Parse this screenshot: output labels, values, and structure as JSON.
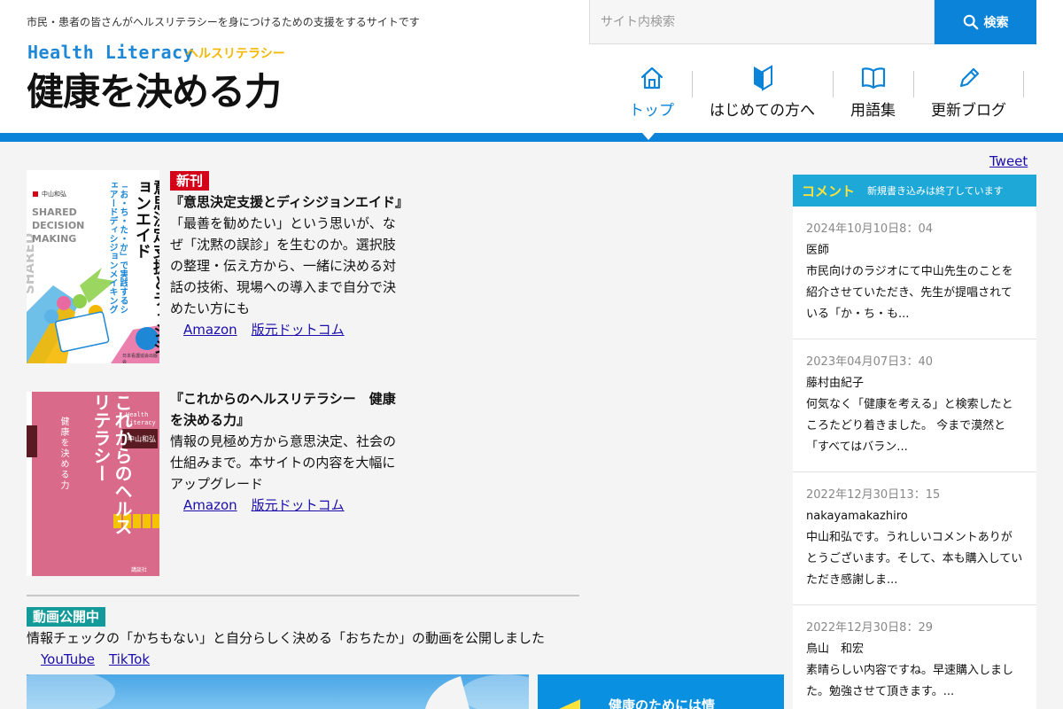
{
  "header": {
    "tagline": "市民・患者の皆さんがヘルスリテラシーを身につけるための支援をするサイトです",
    "brand_en": "Health Literacy",
    "brand_ja_sub": "ヘルスリテラシー",
    "brand_title": "健康を決める力"
  },
  "search": {
    "placeholder": "サイト内検索",
    "button_label": "検索"
  },
  "nav": [
    {
      "label": "トップ",
      "icon": "home-icon",
      "active": true
    },
    {
      "label": "はじめての方へ",
      "icon": "beginner-mark-icon",
      "active": false
    },
    {
      "label": "用語集",
      "icon": "book-icon",
      "active": false
    },
    {
      "label": "更新ブログ",
      "icon": "pencil-icon",
      "active": false
    }
  ],
  "colors": {
    "primary_blue": "#0a83d8",
    "brand_yellow": "#f5b800",
    "new_badge_red": "#d4001a",
    "video_badge_teal": "#159a9a",
    "comments_head": "#1ea8d8"
  },
  "tweet_label": "Tweet",
  "books": [
    {
      "badge": "新刊",
      "title": "『意思決定支援とディシジョンエイド』",
      "description": "「最善を勧めたい」という思いが、なぜ「沈黙の誤診」を生むのか。選択肢の整理・伝え方から、一緒に決める対話の技術、現場への導入まで自分で決めたい方にも",
      "links": [
        "Amazon",
        "版元ドットコム"
      ],
      "cover": {
        "author": "中山和弘",
        "title": "意思決定支援とディシジョンエイド",
        "subtitle": "「お・ち・た・か」で実践するシェアードディシジョンメイキング",
        "en": "SHARED DECISION MAKING",
        "publisher": "日本看護協会出版会"
      }
    },
    {
      "badge": "",
      "title": "『これからのヘルスリテラシー　健康を決める力』",
      "description": "情報の見極め方から意思決定、社会の仕組みまで。本サイトの内容を大幅にアップグレード",
      "links": [
        "Amazon",
        "版元ドットコム"
      ],
      "cover": {
        "author": "中山和弘",
        "title": "これからのヘルスリテラシー",
        "subtitle": "健康を決める力",
        "en": "Health Literacy",
        "publisher": "講談社"
      }
    }
  ],
  "video": {
    "badge": "動画公開中",
    "text": "情報チェックの「かちもない」と自分らしく決める「おちたか」の動画を公開しました",
    "links": [
      "YouTube",
      "TikTok"
    ]
  },
  "banner_text": "健康のためには情",
  "comments": {
    "title": "コメント",
    "note": "新規書き込みは終了しています",
    "items": [
      {
        "date": "2024年10月10日8：04",
        "author": "医師",
        "body": "市民向けのラジオにて中山先生のことを紹介させていただき、先生が提唱されている「か・ち・も..."
      },
      {
        "date": "2023年04月07日3：40",
        "author": "藤村由紀子",
        "body": "何気なく「健康を考える」と検索したところたどり着きました。 今まで漠然と「すべてはバラン..."
      },
      {
        "date": "2022年12月30日13：15",
        "author": "nakayamakazhiro",
        "body": "中山和弘です。うれしいコメントありがとうございます。そして、本も購入していただき感謝しま..."
      },
      {
        "date": "2022年12月30日8：29",
        "author": "鳥山　和宏",
        "body": "素晴らしい内容ですね。早速購入しました。勉強させて頂きます。..."
      }
    ]
  }
}
